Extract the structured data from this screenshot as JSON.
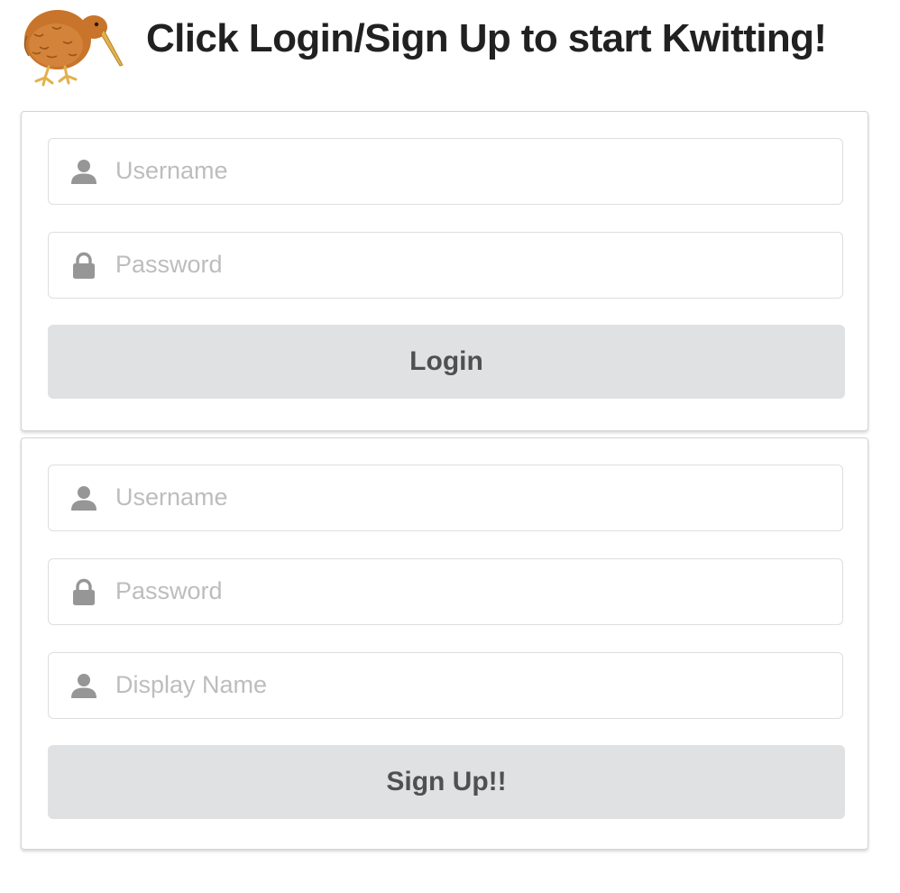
{
  "header": {
    "title": "Click Login/Sign Up to start Kwitting!",
    "logo_icon": "kiwi-bird-logo"
  },
  "colors": {
    "kiwi_body": "#c8742a",
    "kiwi_body_dark": "#9a5418",
    "kiwi_beak": "#e3b04b",
    "icon_gray": "#969696",
    "placeholder": "#bdbdbd",
    "button_bg": "#e0e1e2",
    "button_text": "#505050",
    "border": "#d4d4d5"
  },
  "login": {
    "username": {
      "placeholder": "Username",
      "value": "",
      "icon": "user-icon"
    },
    "password": {
      "placeholder": "Password",
      "value": "",
      "icon": "lock-icon"
    },
    "submit_label": "Login"
  },
  "signup": {
    "username": {
      "placeholder": "Username",
      "value": "",
      "icon": "user-icon"
    },
    "password": {
      "placeholder": "Password",
      "value": "",
      "icon": "lock-icon"
    },
    "display_name": {
      "placeholder": "Display Name",
      "value": "",
      "icon": "user-icon"
    },
    "submit_label": "Sign Up!!"
  }
}
